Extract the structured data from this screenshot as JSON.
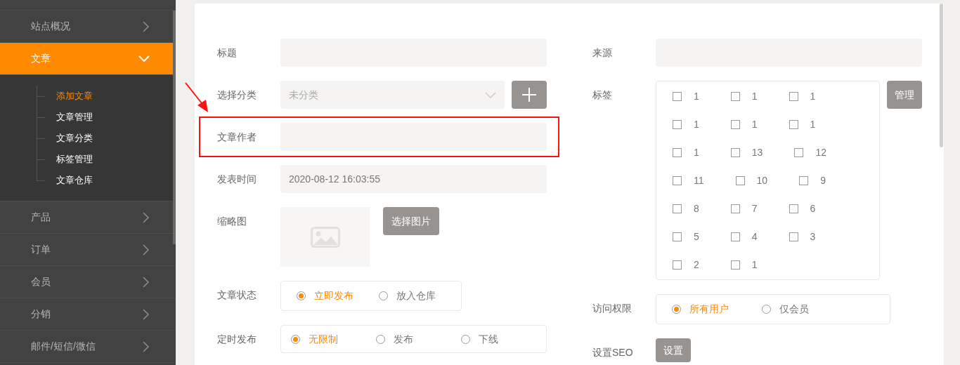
{
  "sidebar": {
    "items": [
      {
        "label": "站点概况",
        "selected": false,
        "expanded": false
      },
      {
        "label": "文章",
        "selected": true,
        "expanded": true,
        "children": [
          {
            "label": "添加文章",
            "selected": true
          },
          {
            "label": "文章管理",
            "selected": false
          },
          {
            "label": "文章分类",
            "selected": false
          },
          {
            "label": "标签管理",
            "selected": false
          },
          {
            "label": "文章仓库",
            "selected": false
          }
        ]
      },
      {
        "label": "产品",
        "selected": false,
        "expanded": false
      },
      {
        "label": "订单",
        "selected": false,
        "expanded": false
      },
      {
        "label": "会员",
        "selected": false,
        "expanded": false
      },
      {
        "label": "分销",
        "selected": false,
        "expanded": false
      },
      {
        "label": "邮件/短信/微信",
        "selected": false,
        "expanded": false
      }
    ]
  },
  "form": {
    "left": [
      {
        "kind": "input",
        "label": "标题"
      },
      {
        "kind": "select",
        "label": "选择分类",
        "value": "未分类"
      },
      {
        "kind": "input",
        "label": "文章作者",
        "highlighted": true
      },
      {
        "kind": "input",
        "label": "发表时间",
        "value": "2020-08-12 16:03:55"
      },
      {
        "kind": "image",
        "label": "缩略图",
        "button": "选择图片"
      },
      {
        "kind": "radio",
        "label": "文章状态",
        "options": [
          {
            "label": "立即发布",
            "selected": true
          },
          {
            "label": "放入仓库",
            "selected": false
          }
        ]
      },
      {
        "kind": "radio",
        "label": "定时发布",
        "options": [
          {
            "label": "无限制",
            "selected": true
          },
          {
            "label": "发布",
            "selected": false
          },
          {
            "label": "下线",
            "selected": false
          }
        ]
      }
    ],
    "right": [
      {
        "kind": "input",
        "label": "来源"
      },
      {
        "kind": "tags",
        "label": "标签",
        "button": "管理",
        "tags": [
          {
            "label": "1",
            "checked": false
          },
          {
            "label": "1",
            "checked": false
          },
          {
            "label": "1",
            "checked": false
          },
          {
            "label": "1",
            "checked": false
          },
          {
            "label": "1",
            "checked": false
          },
          {
            "label": "1",
            "checked": false
          },
          {
            "label": "1",
            "checked": false
          },
          {
            "label": "13",
            "checked": false
          },
          {
            "label": "12",
            "checked": false
          },
          {
            "label": "11",
            "checked": false
          },
          {
            "label": "10",
            "checked": false
          },
          {
            "label": "9",
            "checked": false
          },
          {
            "label": "8",
            "checked": false
          },
          {
            "label": "7",
            "checked": false
          },
          {
            "label": "6",
            "checked": false
          },
          {
            "label": "5",
            "checked": false
          },
          {
            "label": "4",
            "checked": false
          },
          {
            "label": "3",
            "checked": false
          },
          {
            "label": "2",
            "checked": false
          },
          {
            "label": "1",
            "checked": false
          }
        ]
      },
      {
        "kind": "radio",
        "label": "访问权限",
        "options": [
          {
            "label": "所有用户",
            "selected": true
          },
          {
            "label": "仅会员",
            "selected": false
          }
        ]
      },
      {
        "kind": "button",
        "label": "设置SEO",
        "button": "设置"
      }
    ]
  }
}
